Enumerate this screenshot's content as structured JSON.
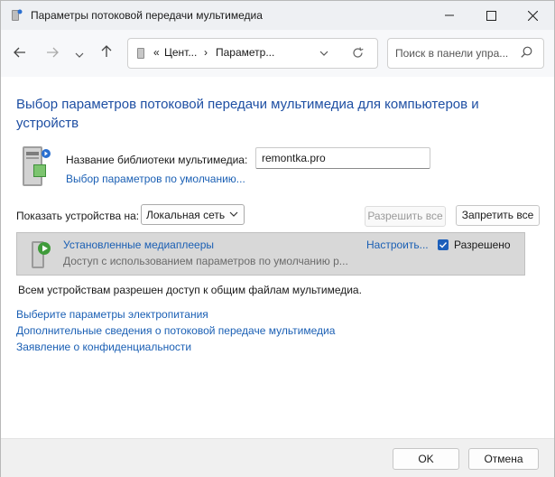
{
  "window": {
    "title": "Параметры потоковой передачи мультимедиа",
    "app_icon": "media-server-icon",
    "minimize_icon": "minimize-icon",
    "maximize_icon": "maximize-icon",
    "close_icon": "close-icon"
  },
  "nav": {
    "back_icon": "arrow-left-icon",
    "forward_icon": "arrow-right-icon",
    "recent_icon": "chevron-down-icon",
    "up_icon": "arrow-up-icon",
    "address": {
      "prefix": "«",
      "crumb1": "Цент...",
      "sep": "›",
      "crumb2": "Параметр...",
      "dropdown_icon": "chevron-down-icon",
      "refresh_icon": "refresh-icon"
    },
    "search_placeholder": "Поиск в панели упра...",
    "search_icon": "search-icon"
  },
  "main": {
    "heading": "Выбор параметров потоковой передачи мультимедиа для компьютеров и устройств",
    "library_label": "Название библиотеки мультимедиа:",
    "library_value": "remontka.pro",
    "defaults_link": "Выбор параметров по умолчанию...",
    "show_devices_label": "Показать устройства на:",
    "show_devices_value": "Локальная сеть",
    "allow_all_button": "Разрешить все",
    "block_all_button": "Запретить все",
    "device": {
      "name": "Установленные медиаплееры",
      "description": "Доступ с использованием параметров по умолчанию р...",
      "configure_link": "Настроить...",
      "allowed_label": "Разрешено",
      "allowed_checked": true
    },
    "status_text": "Всем устройствам разрешен доступ к общим файлам мультимедиа.",
    "links": [
      "Выберите параметры электропитания",
      "Дополнительные сведения о потоковой передаче мультимедиа",
      "Заявление о конфиденциальности"
    ]
  },
  "footer": {
    "ok_button": "OK",
    "cancel_button": "Отмена"
  },
  "colors": {
    "link": "#1a5fb4",
    "heading": "#1e4fa3",
    "accent": "#1c5fba"
  }
}
